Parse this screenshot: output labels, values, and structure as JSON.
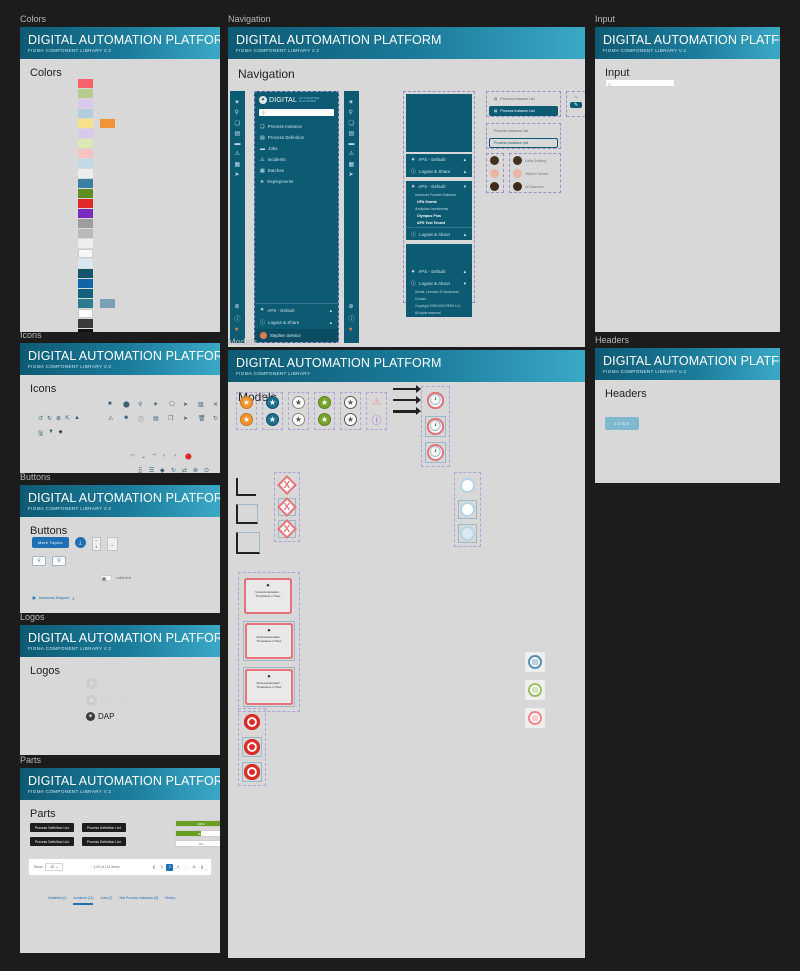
{
  "app": {
    "title": "DIGITAL AUTOMATION PLATFORM",
    "subtitle": "FIGMA COMPONENT LIBRARY V.2",
    "subtitle_short": "FIGMA COMPONENT LIBRARY",
    "brand_primary": "#0d5a73",
    "brand_accent": "#3aa9c6",
    "canvas_bg": "#1c1c1c",
    "frame_bg": "#d8d8d8"
  },
  "frames": {
    "colors": "Colors",
    "navigation": "Navigation",
    "input": "Input",
    "icons": "Icons",
    "models": "Models",
    "headers": "Headers",
    "buttons": "Buttons",
    "logos": "Logos",
    "parts": "Parts"
  },
  "colors_panel": {
    "heading": "Colors",
    "swatches": [
      "#f4646a",
      "#b6cc8e",
      "#d9c9ec",
      "#b3cfdd",
      "#f7e08a",
      "#d9c9ec",
      "#dde8b5",
      "#f6c4c0",
      "#c3dae6",
      "#ededed",
      "#3d7fa3",
      "#5f8e1e",
      "#e02a28",
      "#7a2bbd",
      "#9d9d9d",
      "#b9b9b9",
      "#ededed",
      "#f7f7f7",
      "#d7e8f2",
      "#12556b",
      "#1263a8",
      "#13617a",
      "#2d7b91",
      "#ffffff",
      "#3a3a3a",
      "#111111"
    ],
    "extra_swatches": [
      {
        "index": 4,
        "color": "#f09436"
      },
      {
        "index": 22,
        "color": "#7ba0b5"
      }
    ]
  },
  "navigation_panel": {
    "heading": "Navigation",
    "logo_primary": "DIGITAL",
    "logo_secondary_1": "AUTOMATION",
    "logo_secondary_2": "PLATFORM",
    "search_placeholder": "Search",
    "rail_icons": [
      "gear-icon",
      "search-icon",
      "process-instance-icon",
      "file-icon",
      "briefcase-icon",
      "warning-icon",
      "batch-icon",
      "rocket-icon"
    ],
    "rail_footer_icons": [
      "globe-icon",
      "info-icon",
      "avatar-icon"
    ],
    "menu_items": [
      {
        "label": "Process Instance",
        "icon": "process-instance-icon"
      },
      {
        "label": "Process Definition",
        "icon": "file-icon"
      },
      {
        "label": "Jobs",
        "icon": "briefcase-icon"
      },
      {
        "label": "Incidents",
        "icon": "warning-icon"
      },
      {
        "label": "Batches",
        "icon": "batch-icon"
      },
      {
        "label": "Deployments",
        "icon": "rocket-icon"
      }
    ],
    "footer_items": [
      {
        "label": "APS - Default",
        "icon": "gear-icon",
        "chevron": "▲"
      },
      {
        "label": "Logout & Share",
        "icon": "info-icon",
        "chevron": "▲"
      }
    ],
    "user": {
      "label": "Stephen Service",
      "avatar": "avatar-icon"
    },
    "dropdown_expanded": {
      "title": "APS - Default",
      "chevron": "▼",
      "group_1_label": "Advanced Provider Solutions",
      "group_1_items": [
        "UPA Grants"
      ],
      "group_2_label": "Workplace Investments",
      "group_2_items": [
        "Olympus Plus",
        "APS Test Tenant"
      ],
      "footer_label": "Logout & About",
      "footer_chevron": "▲"
    },
    "legal_expanded": {
      "title": "APS - Default",
      "chevron": "▲",
      "footer_label": "Logout & About",
      "footer_chevron": "▼",
      "links": [
        "Deeds, Licenses & Disclosures",
        "Contact",
        "Copyright 1998-2024 PARS LLC",
        "All rights reserved."
      ]
    },
    "list_items": [
      {
        "label": "Process Instance List",
        "state": "default"
      },
      {
        "label": "Process Instance List",
        "state": "selected"
      },
      {
        "label": "Process Instance List",
        "state": "muted"
      },
      {
        "label": "Process Instance List",
        "state": "outline"
      }
    ],
    "avatar_rows": [
      {
        "name": "Kathy Schilling",
        "color": "#46301f"
      },
      {
        "name": "Stephen Service",
        "color": "#e8b6a4"
      },
      {
        "name": "Gil Saunders",
        "color": "#3d2a1c"
      }
    ],
    "icon_buttons": [
      "pencil-icon",
      "edit-square-icon"
    ]
  },
  "input_panel": {
    "heading": "Input",
    "search_placeholder": "Search",
    "search_value": "",
    "search_icon": "search-icon"
  },
  "icons_panel": {
    "heading": "Icons",
    "row_1": [
      "stop-icon",
      "record-icon",
      "search-icon",
      "gear-icon",
      "comment-icon",
      "rocket-icon",
      "chart-icon",
      "close-icon"
    ],
    "row_2": [
      "warning-icon",
      "user-circle-icon",
      "info-icon",
      "file-icon",
      "copy-icon",
      "send-icon",
      "trash-icon",
      "refresh-icon"
    ],
    "row_3": [
      "undo-icon",
      "redo-icon",
      "add-circle-icon",
      "external-link-icon",
      "up-arrow-icon"
    ],
    "row_4": [
      "save-icon",
      "filter-icon",
      "gear-dark-icon"
    ],
    "row_5": [
      "spinner-icon",
      "chevron-down-icon",
      "chevron-up-icon",
      "chevron-left-icon",
      "chevron-right-icon",
      "dot-red-icon"
    ],
    "row_6": [
      "grid-icon",
      "list-icon",
      "diamond-icon",
      "rotate-icon",
      "swap-icon",
      "plus-circle-icon",
      "help-circle-icon"
    ]
  },
  "buttons_panel": {
    "heading": "Buttons",
    "primary_label": "More Topics",
    "round_icon": "download-icon",
    "square_icons": [
      "search-icon",
      "search-icon"
    ],
    "stepper_icons": [
      "chevron-up-icon",
      "chevron-down-icon"
    ],
    "stepper_value": "1",
    "dropdown_icon": "chevron-down-icon",
    "toggle_label": "Label text",
    "toggle_state": "off",
    "link_label": "Download Diagram",
    "link_icon": "download-icon"
  },
  "logos_panel": {
    "heading": "Logos",
    "mark_only": "gear-icon",
    "wordmark_primary": "DIGITAL",
    "wordmark_secondary_1": "AUTOMATION",
    "wordmark_secondary_2": "PLATFORM",
    "short_mark": "DAP"
  },
  "headers_panel": {
    "heading": "Headers",
    "badge_label": "JOBS"
  },
  "parts_panel": {
    "heading": "Parts",
    "chips": [
      "Process Definition List",
      "Process Definition List",
      "Process Definition List",
      "Process Definition List"
    ],
    "progress_bars": [
      {
        "value": 100,
        "label": "100%",
        "style": "filled"
      },
      {
        "value": 50,
        "label": "50%",
        "style": "partial"
      },
      {
        "value": 0,
        "label": "0%",
        "style": "empty"
      }
    ],
    "pager": {
      "show_label": "Show",
      "show_value": "10",
      "summary": "1-20 of 121 items",
      "first_icon": "❮",
      "last_icon": "❯",
      "pages": [
        "1",
        "2",
        "3",
        "...",
        "11"
      ],
      "active_page": "2"
    },
    "tabs": [
      {
        "label": "Variables (0)",
        "active": false
      },
      {
        "label": "Incidents (12)",
        "active": true
      },
      {
        "label": "Jobs (2)",
        "active": false
      },
      {
        "label": "Sub Process Instances (6)",
        "active": false
      },
      {
        "label": "History",
        "active": false
      }
    ]
  },
  "models_panel": {
    "heading": "Models",
    "stars": [
      {
        "fill": "#f09436",
        "stroke": "#c97618"
      },
      {
        "fill": "#1f6f8f",
        "stroke": "#0d4f68"
      },
      {
        "fill": "#ffffff",
        "stroke": "#888888"
      },
      {
        "fill": "#7aa32e",
        "stroke": "#5c7d21"
      },
      {
        "fill": "#ffffff",
        "stroke": "#555555"
      }
    ],
    "alert_badges": [
      {
        "icon": "warning-icon",
        "color": "#f08a8a"
      },
      {
        "icon": "info-icon",
        "color": "#9b5cc9"
      }
    ],
    "sequence_flows": [
      "solid-arrow",
      "double-arrow",
      "thick-arrow"
    ],
    "boundary_shapes": [
      "angle-plain",
      "angle-boxed",
      "angle-boxed-large"
    ],
    "clock_events": {
      "columns": [
        "#3a3a3a",
        "#5b8db5",
        "#7aa32e",
        "#e8737a"
      ],
      "rows": 3,
      "icon": "clock-icon"
    },
    "gateways": {
      "columns": [
        "#2a2a2a",
        "#5b8db5",
        "#7aa32e",
        "#e8737a"
      ],
      "rows": 3,
      "label": "X"
    },
    "plain_events": {
      "columns": [
        "#cccccc",
        "#b6d4e6"
      ],
      "rows": 3
    },
    "task_card": {
      "label": "Uinta Automation - Timeliness 1 Hour",
      "icon": "gear-icon",
      "columns": [
        "#3a3a3a",
        "#5b8db5",
        "#7aa32e",
        "#e8737a"
      ],
      "rows": 3
    },
    "event_circles": {
      "hollow_columns": [
        "#1a1a1a",
        "#8fb8d4",
        "#9dbf62",
        "#f59aa0"
      ],
      "filled_columns": [
        "#111111",
        "#2f6f9e",
        "#6a9e23",
        "#e02a28"
      ],
      "rows": 3
    },
    "side_badges": [
      {
        "color": "#5b8db5",
        "icon": "task-icon"
      },
      {
        "color": "#9dbf62",
        "icon": "task-icon"
      },
      {
        "color": "#f08a8a",
        "icon": "task-icon"
      }
    ]
  }
}
